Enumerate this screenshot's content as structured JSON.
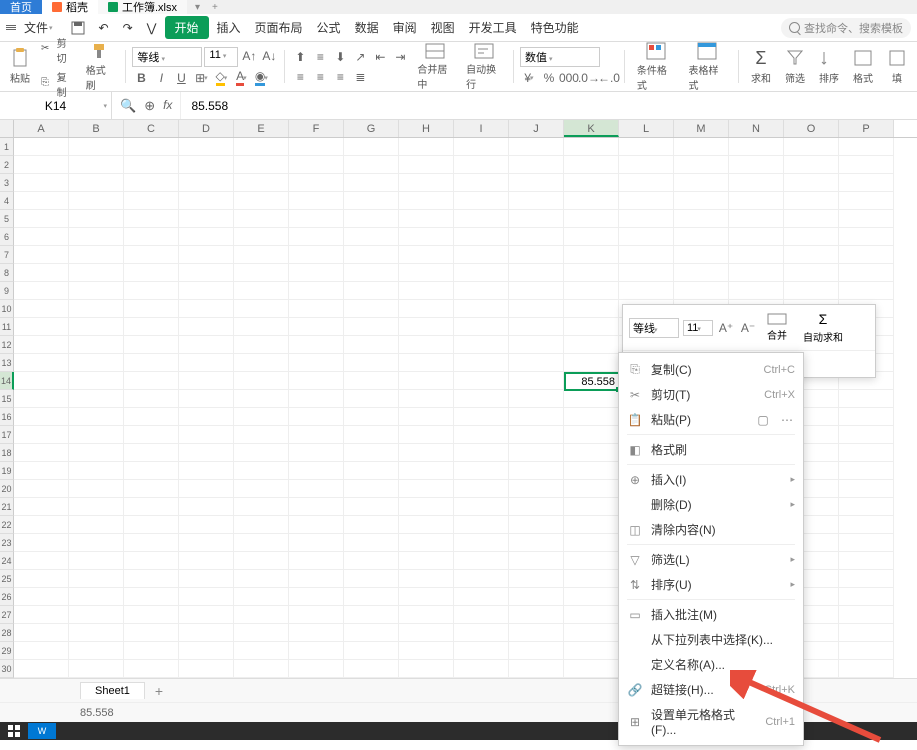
{
  "tabs": {
    "home": "首页",
    "doc": "稻壳",
    "file": "工作簿.xlsx"
  },
  "menu": {
    "file": "文件",
    "start": "开始",
    "insert": "插入",
    "page_layout": "页面布局",
    "formula": "公式",
    "data": "数据",
    "review": "审阅",
    "view": "视图",
    "developer": "开发工具",
    "special": "特色功能",
    "search_placeholder": "查找命令、搜索模板"
  },
  "ribbon": {
    "paste": "粘贴",
    "cut": "剪切",
    "copy": "复制",
    "format_painter": "格式刷",
    "font_name": "等线",
    "font_size": "11",
    "merge_center": "合并居中",
    "wrap_text": "自动换行",
    "number_format": "数值",
    "cond_format": "条件格式",
    "table_style": "表格样式",
    "sum": "求和",
    "filter": "筛选",
    "sort": "排序",
    "format": "格式",
    "fill": "填"
  },
  "formula_bar": {
    "cell_ref": "K14",
    "value": "85.558"
  },
  "columns": [
    "A",
    "B",
    "C",
    "D",
    "E",
    "F",
    "G",
    "H",
    "I",
    "J",
    "K",
    "L",
    "M",
    "N",
    "O",
    "P"
  ],
  "active_cell": {
    "col": "K",
    "row": 14,
    "value": "85.558"
  },
  "mini_toolbar": {
    "font_name": "等线",
    "font_size": "11",
    "merge": "合并",
    "autosum": "自动求和"
  },
  "context_menu": {
    "copy": "复制(C)",
    "copy_sc": "Ctrl+C",
    "cut": "剪切(T)",
    "cut_sc": "Ctrl+X",
    "paste": "粘贴(P)",
    "format_painter": "格式刷",
    "insert": "插入(I)",
    "delete": "删除(D)",
    "clear": "清除内容(N)",
    "filter": "筛选(L)",
    "sort": "排序(U)",
    "comment": "插入批注(M)",
    "dropdown": "从下拉列表中选择(K)...",
    "define_name": "定义名称(A)...",
    "hyperlink": "超链接(H)...",
    "hyperlink_sc": "Ctrl+K",
    "format_cells": "设置单元格格式(F)...",
    "format_cells_sc": "Ctrl+1"
  },
  "sheet": {
    "name": "Sheet1"
  },
  "status": {
    "value": "85.558"
  }
}
